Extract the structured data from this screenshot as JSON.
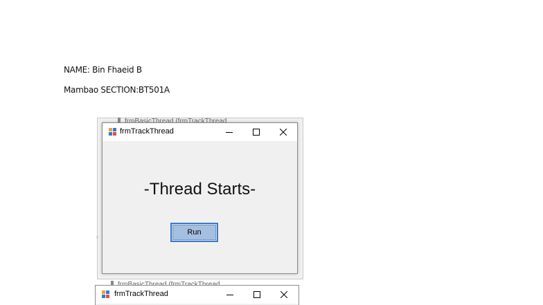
{
  "document": {
    "line1": "NAME: Bin Fhaeid B",
    "line2": "Mambao SECTION:BT501A"
  },
  "background_window": {
    "title_fragment": "frmBasicThread (frmTrackThread"
  },
  "main_window": {
    "title": "frmTrackThread",
    "label": "-Thread Starts-",
    "run_button_label": "Run",
    "icons": {
      "app": "winforms-app-icon",
      "minimize": "minimize-icon",
      "maximize": "maximize-icon",
      "close": "close-icon"
    }
  },
  "second_window": {
    "title": "frmTrackThread",
    "back_title_fragment": "frmBasicThread (frmTrackThread"
  },
  "colors": {
    "window_bg": "#f0f0f0",
    "button_focus_border": "#3c78c8",
    "button_fill": "#a5bfdf"
  }
}
